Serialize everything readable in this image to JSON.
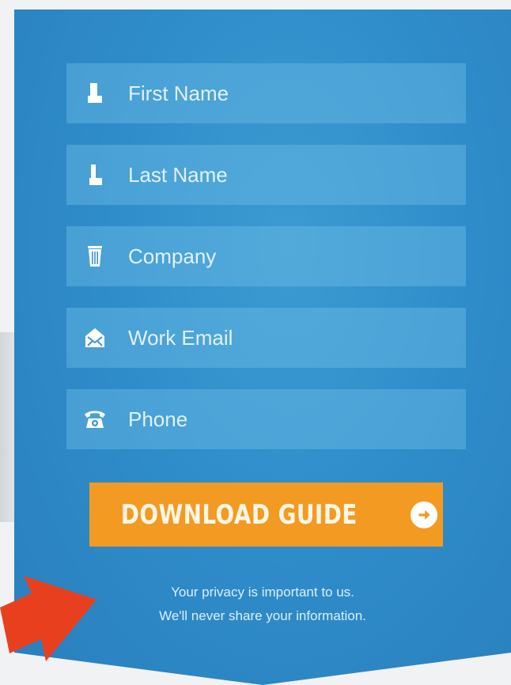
{
  "form": {
    "fields": [
      {
        "name": "first-name",
        "placeholder": "First Name",
        "icon": "person-icon"
      },
      {
        "name": "last-name",
        "placeholder": "Last Name",
        "icon": "person-icon"
      },
      {
        "name": "company",
        "placeholder": "Company",
        "icon": "building-icon"
      },
      {
        "name": "work-email",
        "placeholder": "Work Email",
        "icon": "envelope-icon"
      },
      {
        "name": "phone",
        "placeholder": "Phone",
        "icon": "phone-icon"
      }
    ],
    "submit_label": "DOWNLOAD GUIDE",
    "submit_icon": "arrow-right-circle-icon"
  },
  "privacy": {
    "line1": "Your privacy is important to us.",
    "line2": "We'll never share your information."
  },
  "colors": {
    "panel": "#2f8dca",
    "field": "#6fbee6",
    "button": "#f29a22",
    "pointer_arrow": "#e8401f"
  }
}
